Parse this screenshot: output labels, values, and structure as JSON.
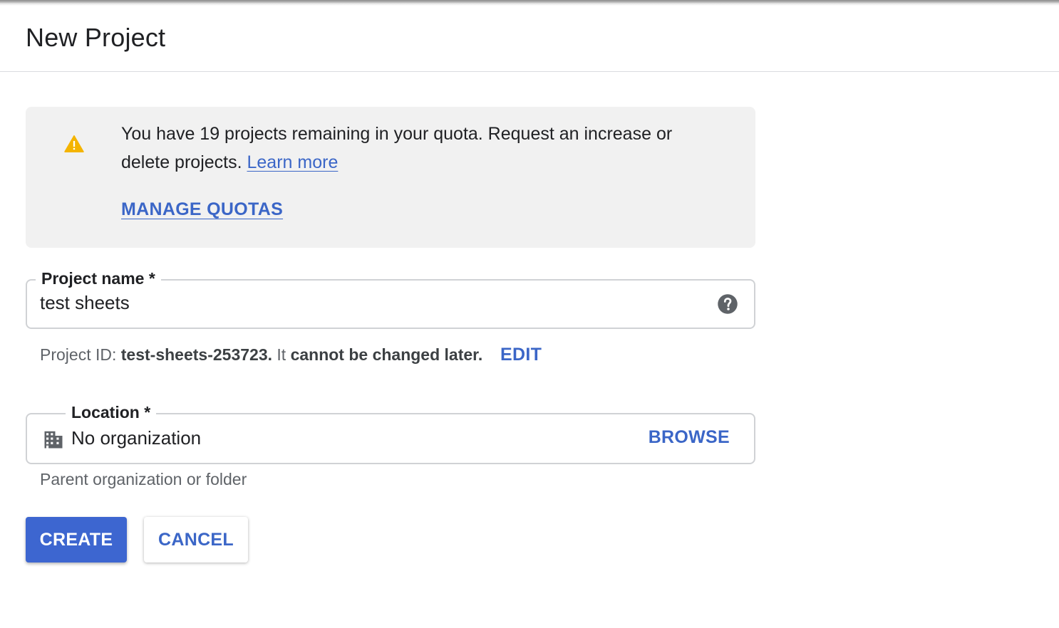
{
  "dialog": {
    "title": "New Project"
  },
  "quota_notice": {
    "icon": "warning-icon",
    "icon_color": "#f4b400",
    "message": "You have 19 projects remaining in your quota. Request an increase or delete projects.",
    "learn_more": "Learn more",
    "manage_quotas": "MANAGE QUOTAS"
  },
  "project_name": {
    "label": "Project name *",
    "value": "test sheets",
    "help_icon": "help-circle-icon"
  },
  "project_id": {
    "prefix": "Project ID:",
    "id_value": "test-sheets-253723.",
    "middle": "It",
    "suffix": "cannot be changed later.",
    "edit_label": "EDIT"
  },
  "location": {
    "label": "Location *",
    "value": "No organization",
    "icon": "building-icon",
    "browse_label": "BROWSE",
    "hint": "Parent organization or folder"
  },
  "actions": {
    "create_label": "CREATE",
    "cancel_label": "CANCEL"
  },
  "colors": {
    "accent": "#3b66c7",
    "primary_button": "#3d66d0",
    "notice_background": "#f1f1f1"
  }
}
